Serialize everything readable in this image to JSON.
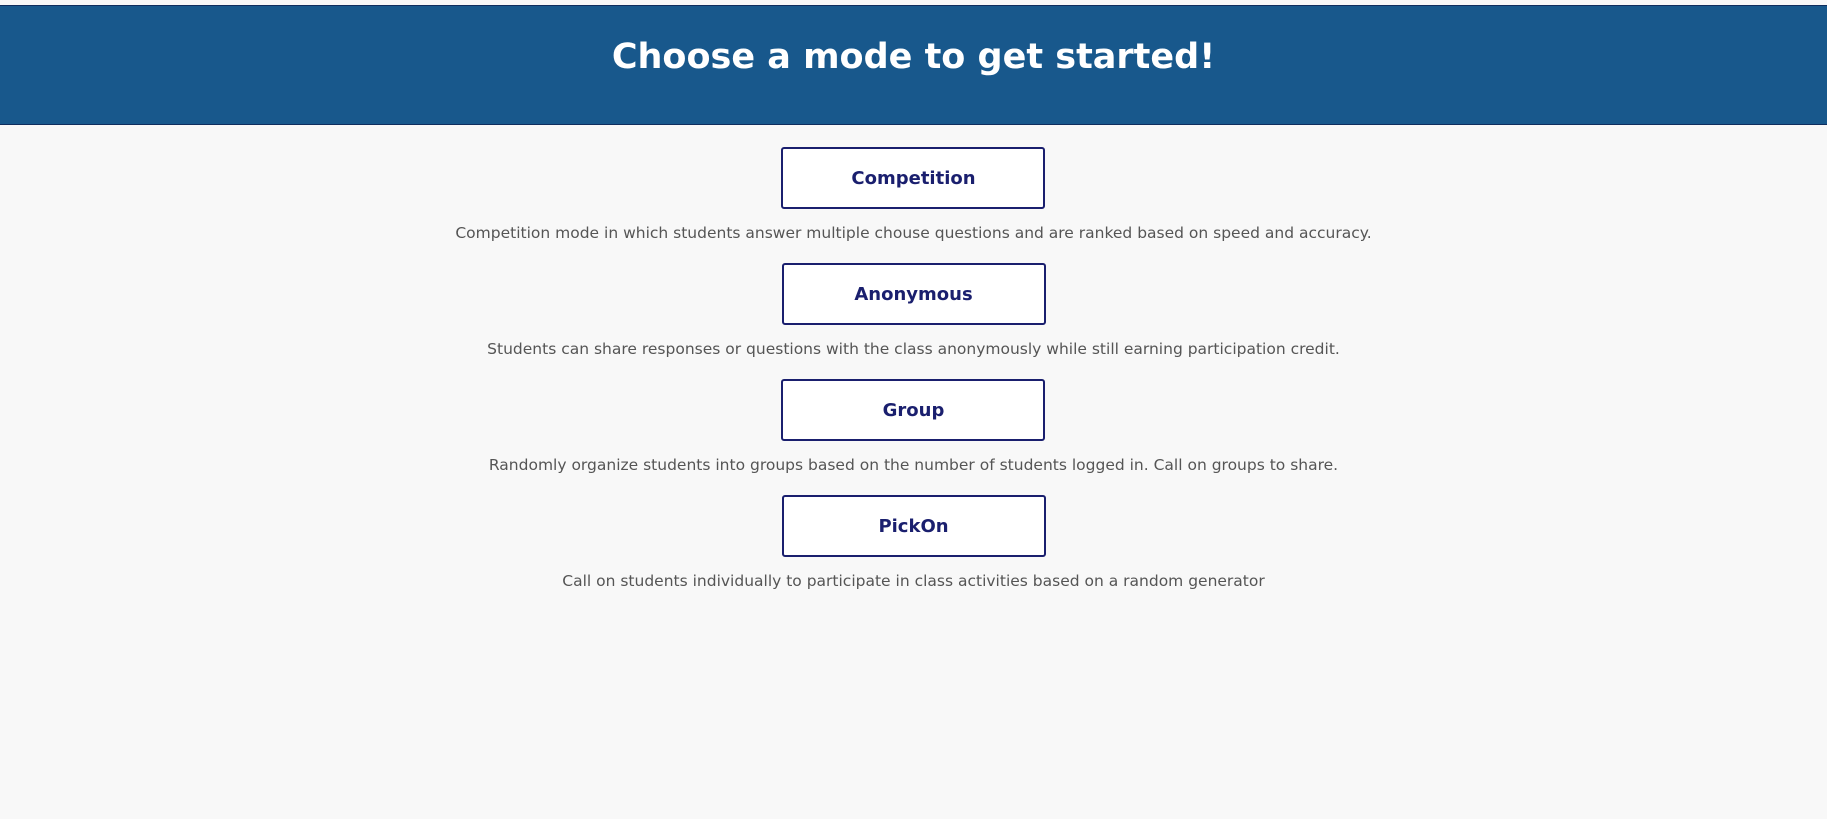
{
  "header": {
    "title": "Choose a mode to get started!"
  },
  "modes": [
    {
      "label": "Competition",
      "description": "Competition mode in which students answer multiple chouse questions and are ranked based on speed and accuracy."
    },
    {
      "label": "Anonymous",
      "description": "Students can share responses or questions with the class anonymously while still earning participation credit."
    },
    {
      "label": "Group",
      "description": "Randomly organize students into groups based on the number of students logged in. Call on groups to share."
    },
    {
      "label": "PickOn",
      "description": "Call on students individually to participate in class activities based on a random generator"
    }
  ],
  "colors": {
    "header_bg": "#18588c",
    "button_border": "#1a1f6e",
    "button_text": "#1a1f6e",
    "page_bg": "#f8f8f8",
    "description_text": "#555555"
  }
}
